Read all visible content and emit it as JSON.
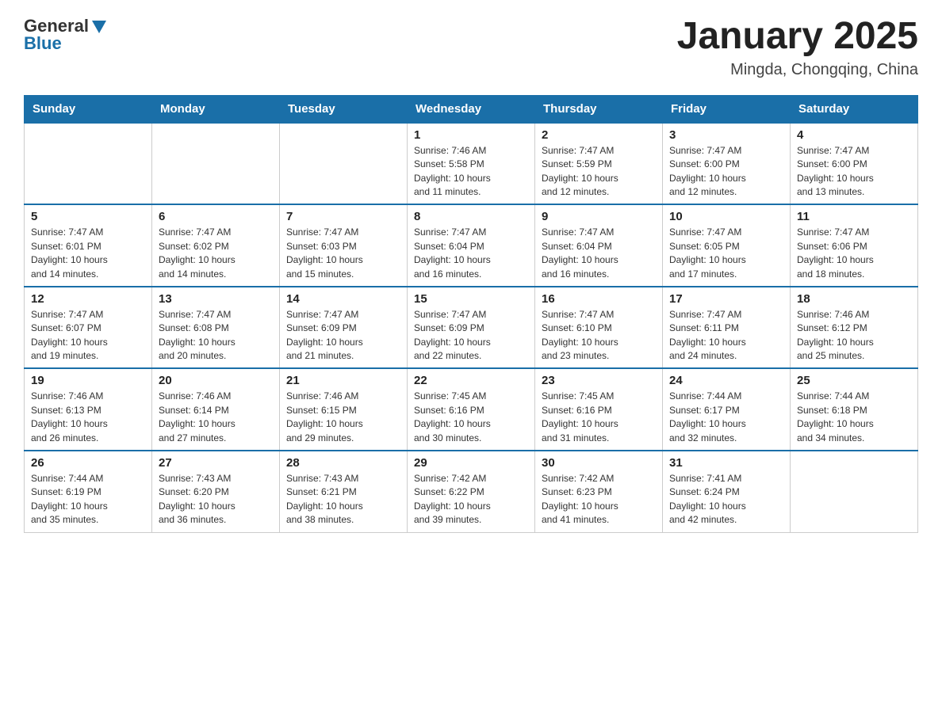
{
  "header": {
    "logo_general": "General",
    "logo_blue": "Blue",
    "month_title": "January 2025",
    "location": "Mingda, Chongqing, China"
  },
  "days_of_week": [
    "Sunday",
    "Monday",
    "Tuesday",
    "Wednesday",
    "Thursday",
    "Friday",
    "Saturday"
  ],
  "weeks": [
    {
      "days": [
        {
          "num": "",
          "info": ""
        },
        {
          "num": "",
          "info": ""
        },
        {
          "num": "",
          "info": ""
        },
        {
          "num": "1",
          "info": "Sunrise: 7:46 AM\nSunset: 5:58 PM\nDaylight: 10 hours\nand 11 minutes."
        },
        {
          "num": "2",
          "info": "Sunrise: 7:47 AM\nSunset: 5:59 PM\nDaylight: 10 hours\nand 12 minutes."
        },
        {
          "num": "3",
          "info": "Sunrise: 7:47 AM\nSunset: 6:00 PM\nDaylight: 10 hours\nand 12 minutes."
        },
        {
          "num": "4",
          "info": "Sunrise: 7:47 AM\nSunset: 6:00 PM\nDaylight: 10 hours\nand 13 minutes."
        }
      ]
    },
    {
      "days": [
        {
          "num": "5",
          "info": "Sunrise: 7:47 AM\nSunset: 6:01 PM\nDaylight: 10 hours\nand 14 minutes."
        },
        {
          "num": "6",
          "info": "Sunrise: 7:47 AM\nSunset: 6:02 PM\nDaylight: 10 hours\nand 14 minutes."
        },
        {
          "num": "7",
          "info": "Sunrise: 7:47 AM\nSunset: 6:03 PM\nDaylight: 10 hours\nand 15 minutes."
        },
        {
          "num": "8",
          "info": "Sunrise: 7:47 AM\nSunset: 6:04 PM\nDaylight: 10 hours\nand 16 minutes."
        },
        {
          "num": "9",
          "info": "Sunrise: 7:47 AM\nSunset: 6:04 PM\nDaylight: 10 hours\nand 16 minutes."
        },
        {
          "num": "10",
          "info": "Sunrise: 7:47 AM\nSunset: 6:05 PM\nDaylight: 10 hours\nand 17 minutes."
        },
        {
          "num": "11",
          "info": "Sunrise: 7:47 AM\nSunset: 6:06 PM\nDaylight: 10 hours\nand 18 minutes."
        }
      ]
    },
    {
      "days": [
        {
          "num": "12",
          "info": "Sunrise: 7:47 AM\nSunset: 6:07 PM\nDaylight: 10 hours\nand 19 minutes."
        },
        {
          "num": "13",
          "info": "Sunrise: 7:47 AM\nSunset: 6:08 PM\nDaylight: 10 hours\nand 20 minutes."
        },
        {
          "num": "14",
          "info": "Sunrise: 7:47 AM\nSunset: 6:09 PM\nDaylight: 10 hours\nand 21 minutes."
        },
        {
          "num": "15",
          "info": "Sunrise: 7:47 AM\nSunset: 6:09 PM\nDaylight: 10 hours\nand 22 minutes."
        },
        {
          "num": "16",
          "info": "Sunrise: 7:47 AM\nSunset: 6:10 PM\nDaylight: 10 hours\nand 23 minutes."
        },
        {
          "num": "17",
          "info": "Sunrise: 7:47 AM\nSunset: 6:11 PM\nDaylight: 10 hours\nand 24 minutes."
        },
        {
          "num": "18",
          "info": "Sunrise: 7:46 AM\nSunset: 6:12 PM\nDaylight: 10 hours\nand 25 minutes."
        }
      ]
    },
    {
      "days": [
        {
          "num": "19",
          "info": "Sunrise: 7:46 AM\nSunset: 6:13 PM\nDaylight: 10 hours\nand 26 minutes."
        },
        {
          "num": "20",
          "info": "Sunrise: 7:46 AM\nSunset: 6:14 PM\nDaylight: 10 hours\nand 27 minutes."
        },
        {
          "num": "21",
          "info": "Sunrise: 7:46 AM\nSunset: 6:15 PM\nDaylight: 10 hours\nand 29 minutes."
        },
        {
          "num": "22",
          "info": "Sunrise: 7:45 AM\nSunset: 6:16 PM\nDaylight: 10 hours\nand 30 minutes."
        },
        {
          "num": "23",
          "info": "Sunrise: 7:45 AM\nSunset: 6:16 PM\nDaylight: 10 hours\nand 31 minutes."
        },
        {
          "num": "24",
          "info": "Sunrise: 7:44 AM\nSunset: 6:17 PM\nDaylight: 10 hours\nand 32 minutes."
        },
        {
          "num": "25",
          "info": "Sunrise: 7:44 AM\nSunset: 6:18 PM\nDaylight: 10 hours\nand 34 minutes."
        }
      ]
    },
    {
      "days": [
        {
          "num": "26",
          "info": "Sunrise: 7:44 AM\nSunset: 6:19 PM\nDaylight: 10 hours\nand 35 minutes."
        },
        {
          "num": "27",
          "info": "Sunrise: 7:43 AM\nSunset: 6:20 PM\nDaylight: 10 hours\nand 36 minutes."
        },
        {
          "num": "28",
          "info": "Sunrise: 7:43 AM\nSunset: 6:21 PM\nDaylight: 10 hours\nand 38 minutes."
        },
        {
          "num": "29",
          "info": "Sunrise: 7:42 AM\nSunset: 6:22 PM\nDaylight: 10 hours\nand 39 minutes."
        },
        {
          "num": "30",
          "info": "Sunrise: 7:42 AM\nSunset: 6:23 PM\nDaylight: 10 hours\nand 41 minutes."
        },
        {
          "num": "31",
          "info": "Sunrise: 7:41 AM\nSunset: 6:24 PM\nDaylight: 10 hours\nand 42 minutes."
        },
        {
          "num": "",
          "info": ""
        }
      ]
    }
  ]
}
